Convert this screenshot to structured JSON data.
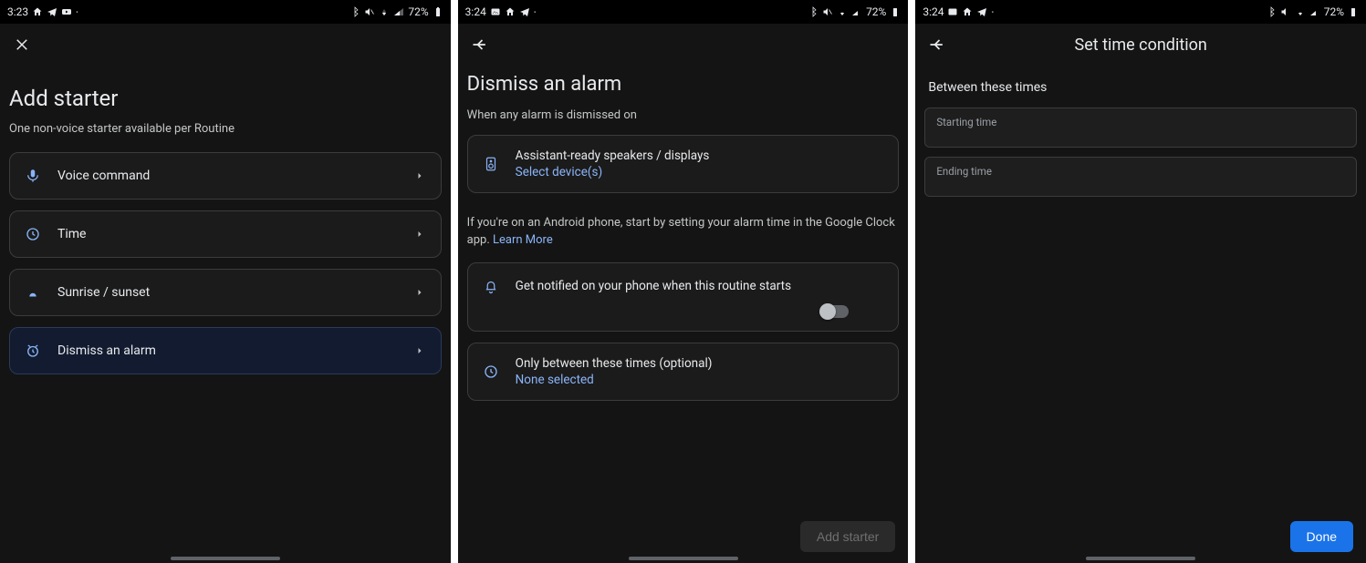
{
  "colors": {
    "accent": "#8ab4f8",
    "primary_btn": "#1a73e8"
  },
  "screen1": {
    "status": {
      "time": "3:23",
      "battery": "72%"
    },
    "title": "Add starter",
    "subtitle": "One non-voice starter available per Routine",
    "options": [
      {
        "id": "voice-command",
        "label": "Voice command",
        "icon": "mic-icon",
        "selected": false
      },
      {
        "id": "time",
        "label": "Time",
        "icon": "clock-icon",
        "selected": false
      },
      {
        "id": "sunrise-sunset",
        "label": "Sunrise / sunset",
        "icon": "sunrise-icon",
        "selected": false
      },
      {
        "id": "dismiss-alarm",
        "label": "Dismiss an alarm",
        "icon": "alarm-icon",
        "selected": true
      }
    ]
  },
  "screen2": {
    "status": {
      "time": "3:24",
      "battery": "72%"
    },
    "title": "Dismiss an alarm",
    "when_line": "When any alarm is dismissed on",
    "device": {
      "label": "Assistant-ready speakers / displays",
      "select_text": "Select device(s)"
    },
    "info_text": "If you're on an Android phone, start by setting your alarm time in the Google Clock app.  ",
    "learn_more": "Learn More",
    "notify": {
      "label": "Get notified on your phone when this routine starts",
      "enabled": false
    },
    "time_cond": {
      "label": "Only between these times (optional)",
      "value": "None selected"
    },
    "add_btn": "Add starter"
  },
  "screen3": {
    "status": {
      "time": "3:24",
      "battery": "72%"
    },
    "title": "Set time condition",
    "section": "Between these times",
    "start_label": "Starting time",
    "end_label": "Ending time",
    "done_btn": "Done"
  }
}
